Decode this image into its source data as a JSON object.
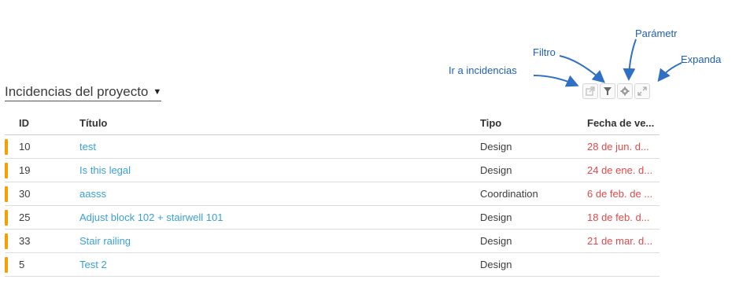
{
  "annotations": {
    "ir_incidencias": "Ir a incidencias",
    "filtro": "Filtro",
    "parametros": "Parámetr",
    "expandir": "Expanda"
  },
  "widget": {
    "title": "Incidencias del proyecto",
    "dropdown_icon": "caret-down-icon"
  },
  "toolbar": {
    "buttons": [
      "external-link-icon",
      "filter-icon",
      "gear-icon",
      "expand-icon"
    ]
  },
  "columns": {
    "id": "ID",
    "title": "Título",
    "type": "Tipo",
    "due": "Fecha de ve..."
  },
  "rows": [
    {
      "id": "10",
      "title": "test",
      "type": "Design",
      "due": "28 de jun. d..."
    },
    {
      "id": "19",
      "title": "Is this legal",
      "type": "Design",
      "due": "24 de ene. d..."
    },
    {
      "id": "30",
      "title": "aasss",
      "type": "Coordination",
      "due": "6 de feb. de ..."
    },
    {
      "id": "25",
      "title": "Adjust block 102 + stairwell 101",
      "type": "Design",
      "due": "18 de feb. d..."
    },
    {
      "id": "33",
      "title": "Stair railing",
      "type": "Design",
      "due": "21 de mar. d..."
    },
    {
      "id": "5",
      "title": "Test 2",
      "type": "Design",
      "due": ""
    }
  ],
  "colors": {
    "priority": "#f5a000",
    "link": "#3aa0d8",
    "overdue": "#e04a4a",
    "annotation": "#1f5fb5"
  }
}
